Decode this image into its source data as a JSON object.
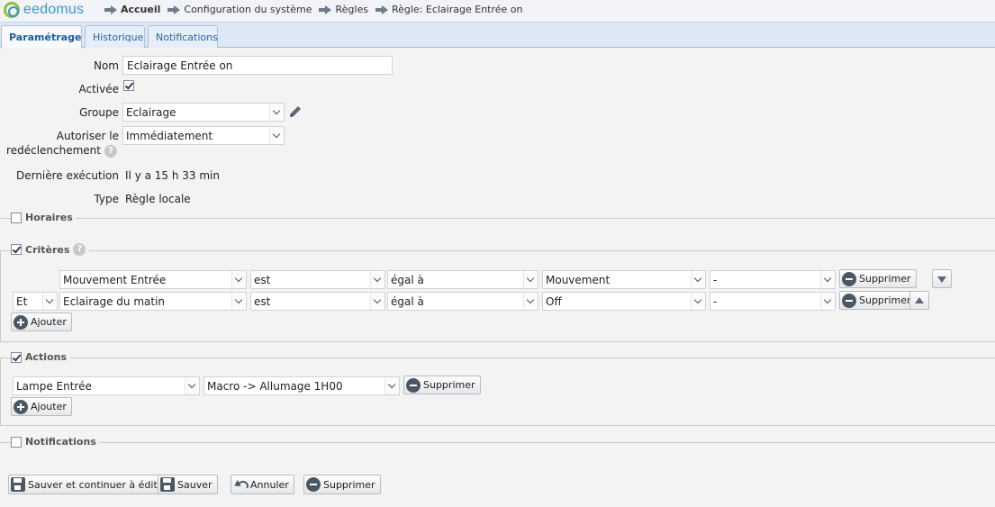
{
  "brand": {
    "name": "eedomus",
    "accent": "#3a9ad2",
    "ring_color": "#8fc13b"
  },
  "breadcrumb": [
    "Accueil",
    "Configuration du système",
    "Règles",
    "Règle: Eclairage Entrée on"
  ],
  "tabs": [
    {
      "label": "Paramétrage",
      "active": true
    },
    {
      "label": "Historique",
      "active": false
    },
    {
      "label": "Notifications",
      "active": false
    }
  ],
  "form": {
    "nom_label": "Nom",
    "nom_value": "Eclairage Entrée on",
    "activee_label": "Activée",
    "activee_checked": true,
    "groupe_label": "Groupe",
    "groupe_value": "Eclairage",
    "redecl_label_line1": "Autoriser le",
    "redecl_label_line2": "redéclenchement",
    "redecl_value": "Immédiatement",
    "derniere_label": "Dernière exécution",
    "derniere_value": "Il y a 15 h 33 min",
    "type_label": "Type",
    "type_value": "Règle locale"
  },
  "sections": {
    "horaires": {
      "label": "Horaires",
      "checked": false
    },
    "criteres": {
      "label": "Critères",
      "checked": true
    },
    "actions": {
      "label": "Actions",
      "checked": true
    },
    "notifications": {
      "label": "Notifications",
      "checked": false
    }
  },
  "criteria": [
    {
      "connector": "",
      "device": "Mouvement Entrée",
      "verb": "est",
      "operator": "égal à",
      "value": "Mouvement",
      "extra": "-",
      "remove_label": "Supprimer",
      "move": "down"
    },
    {
      "connector": "Et",
      "device": "Eclairage du matin",
      "verb": "est",
      "operator": "égal à",
      "value": "Off",
      "extra": "-",
      "remove_label": "Supprimer",
      "move": "up"
    }
  ],
  "criteria_add_label": "Ajouter",
  "actions": [
    {
      "device": "Lampe Entrée",
      "action": "Macro -> Allumage 1H00",
      "remove_label": "Supprimer"
    }
  ],
  "actions_add_label": "Ajouter",
  "footer": {
    "save_continue": "Sauver et continuer à éditer",
    "save": "Sauver",
    "cancel": "Annuler",
    "delete": "Supprimer"
  }
}
